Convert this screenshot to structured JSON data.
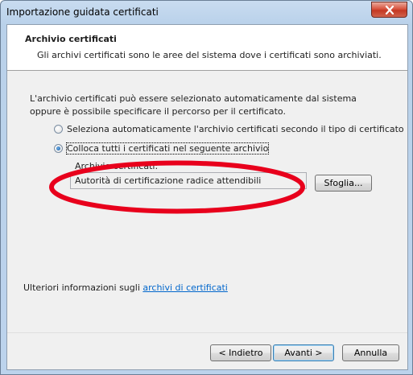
{
  "window": {
    "title": "Importazione guidata certificati"
  },
  "header": {
    "title": "Archivio certificati",
    "description": "Gli archivi certificati sono le aree del sistema dove i certificati sono archiviati."
  },
  "intro": "L'archivio certificati può essere selezionato automaticamente dal sistema oppure è possibile specificare il percorso per il certificato.",
  "options": [
    {
      "label": "Seleziona automaticamente l'archivio certificati secondo il tipo di certificato",
      "checked": false
    },
    {
      "label": "Colloca tutti i certificati nel seguente archivio",
      "checked": true
    }
  ],
  "store": {
    "label": "Archivio certificati:",
    "value": "Autorità di certificazione radice attendibili",
    "browse_label": "Sfoglia..."
  },
  "more_info": {
    "prefix": "Ulteriori informazioni sugli ",
    "link": "archivi di certificati"
  },
  "buttons": {
    "back": "< Indietro",
    "next": "Avanti >",
    "cancel": "Annulla"
  },
  "colors": {
    "annotation": "#e8001c",
    "link": "#0066cc",
    "close_button": "#c43823"
  }
}
